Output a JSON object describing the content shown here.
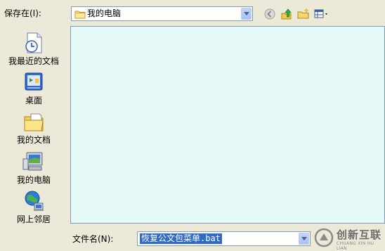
{
  "top": {
    "save_in_label": "保存在(I):",
    "location": "我的电脑"
  },
  "places": [
    {
      "label": "我最近的文档",
      "icon": "recent-documents-icon"
    },
    {
      "label": "桌面",
      "icon": "desktop-icon"
    },
    {
      "label": "我的文档",
      "icon": "my-documents-icon"
    },
    {
      "label": "我的电脑",
      "icon": "my-computer-icon"
    },
    {
      "label": "网上邻居",
      "icon": "network-places-icon"
    }
  ],
  "filename": {
    "label": "文件名(N):",
    "value": "恢复公文包菜单.bat"
  },
  "watermark": {
    "brand": "创新互联",
    "sub": "CHUANG XIN HU LIAN"
  },
  "colors": {
    "dialog_bg": "#ece9d8",
    "list_bg": "#e5f9f9",
    "border": "#7f9db9",
    "selection": "#316ac5"
  }
}
